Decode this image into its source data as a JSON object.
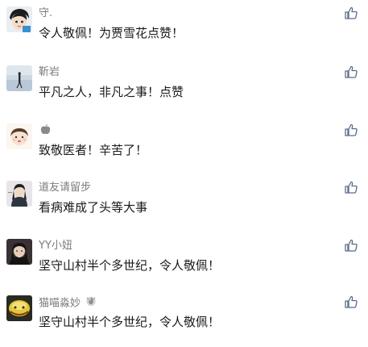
{
  "comments": [
    {
      "username": "守.",
      "text": "令人敬佩！为贾雪花点赞！"
    },
    {
      "username": "靳岩",
      "text": "平凡之人，非凡之事！点赞"
    },
    {
      "username": "",
      "text": "致敬医者！辛苦了！"
    },
    {
      "username": "道友请留步",
      "text": "看病难成了头等大事"
    },
    {
      "username": "YY小妞",
      "text": "坚守山村半个多世纪，令人敬佩！"
    },
    {
      "username": "猫喵淼妙",
      "text": "坚守山村半个多世纪，令人敬佩！"
    }
  ],
  "icons": {
    "like": "thumbs-up-icon",
    "apple": "apple-icon",
    "fire_badge": "fire-badge-icon"
  },
  "colors": {
    "accent": "#5b6b8c",
    "username": "#7b7b7b",
    "text": "#1a1a1a",
    "background": "#ffffff"
  }
}
